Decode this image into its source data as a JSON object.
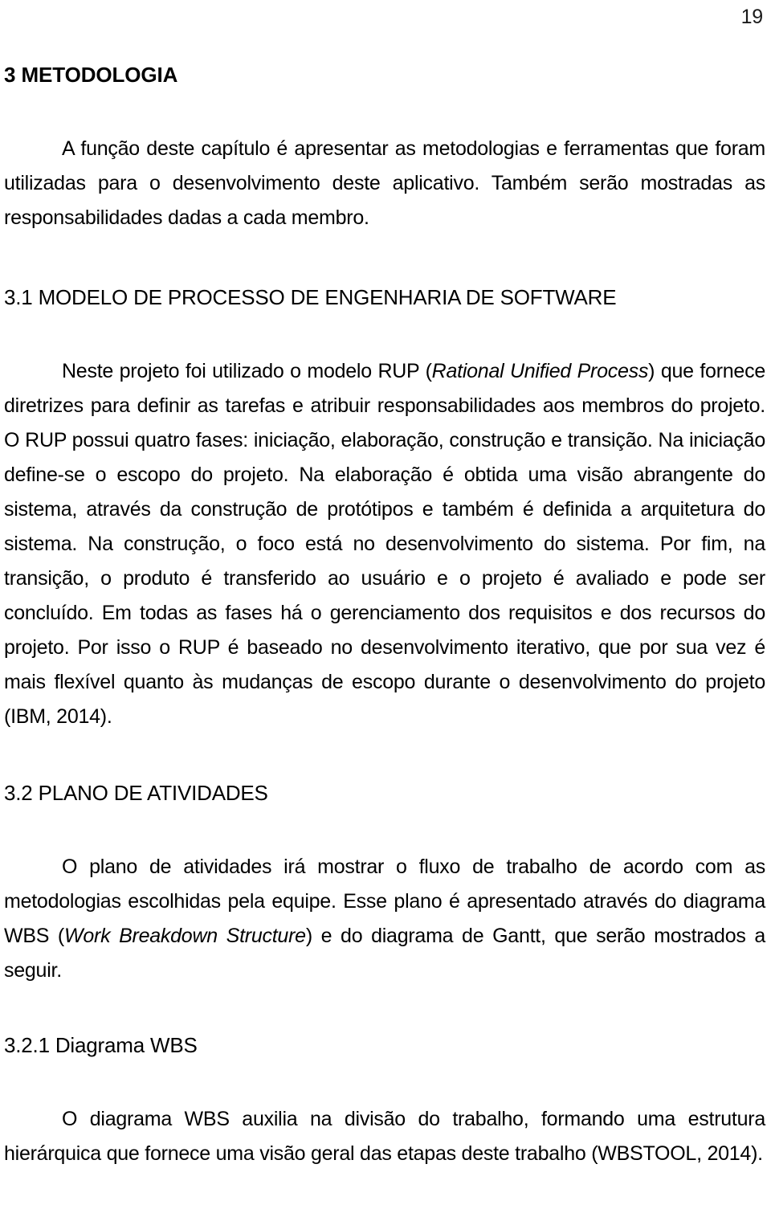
{
  "page": {
    "number": "19"
  },
  "headings": {
    "chapter": "3 METODOLOGIA",
    "section_3_1": "3.1 MODELO DE PROCESSO DE ENGENHARIA DE SOFTWARE",
    "section_3_2": "3.2 PLANO DE ATIVIDADES",
    "section_3_2_1": "3.2.1 Diagrama WBS"
  },
  "paragraphs": {
    "intro": "A função deste capítulo é apresentar as metodologias e ferramentas que foram utilizadas para o desenvolvimento deste aplicativo. Também serão mostradas as responsabilidades dadas a cada membro.",
    "rup_part1": "Neste projeto foi utilizado o modelo RUP (",
    "rup_italic": "Rational Unified Process",
    "rup_part2": ") que fornece diretrizes para definir as tarefas e atribuir responsabilidades aos membros do projeto. O RUP possui quatro fases: iniciação, elaboração, construção e transição. Na iniciação define-se o escopo do projeto. Na elaboração é obtida uma visão abrangente do sistema, através da construção de protótipos e também é definida a arquitetura do sistema. Na construção, o foco está no desenvolvimento do sistema. Por fim, na transição, o produto é transferido ao usuário e o projeto é avaliado e pode ser concluído. Em todas as fases há o gerenciamento dos requisitos e dos recursos do projeto. Por isso o RUP é baseado no desenvolvimento iterativo, que por sua vez é mais flexível quanto às mudanças de escopo durante o desenvolvimento do projeto (IBM, 2014).",
    "plano_part1": "O plano de atividades irá mostrar o fluxo de trabalho de acordo com as metodologias escolhidas pela equipe. Esse plano é apresentado através do diagrama WBS (",
    "plano_italic": "Work Breakdown Structure",
    "plano_part2": ") e do diagrama de Gantt, que serão mostrados a seguir.",
    "wbs": "O diagrama WBS auxilia na divisão do trabalho, formando uma estrutura hierárquica que fornece uma visão geral das etapas deste trabalho (WBSTOOL, 2014)."
  }
}
